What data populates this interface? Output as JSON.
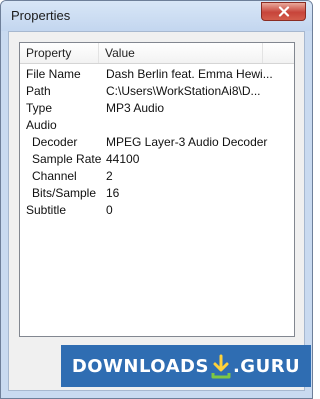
{
  "window": {
    "title": "Properties"
  },
  "list": {
    "columns": [
      "Property",
      "Value"
    ],
    "rows": [
      {
        "property": "File Name",
        "value": "Dash Berlin feat. Emma Hewi...",
        "indent": false
      },
      {
        "property": "Path",
        "value": "C:\\Users\\WorkStationAi8\\D...",
        "indent": false
      },
      {
        "property": "Type",
        "value": "MP3 Audio",
        "indent": false
      },
      {
        "property": "Audio",
        "value": "",
        "indent": false
      },
      {
        "property": "Decoder",
        "value": "MPEG Layer-3 Audio Decoder",
        "indent": true
      },
      {
        "property": "Sample Rate",
        "value": "44100",
        "indent": true
      },
      {
        "property": "Channel",
        "value": "2",
        "indent": true
      },
      {
        "property": "Bits/Sample",
        "value": "16",
        "indent": true
      },
      {
        "property": "Subtitle",
        "value": "0",
        "indent": false
      }
    ]
  },
  "watermark": {
    "text_left": "DOWNLOADS",
    "text_right": ".GURU"
  },
  "icons": {
    "close": "close-icon",
    "watermark": "download-arrow-icon"
  },
  "colors": {
    "titlebar": "#c9daf0",
    "close": "#c7443a",
    "watermark_bg": "#2f6db2"
  }
}
